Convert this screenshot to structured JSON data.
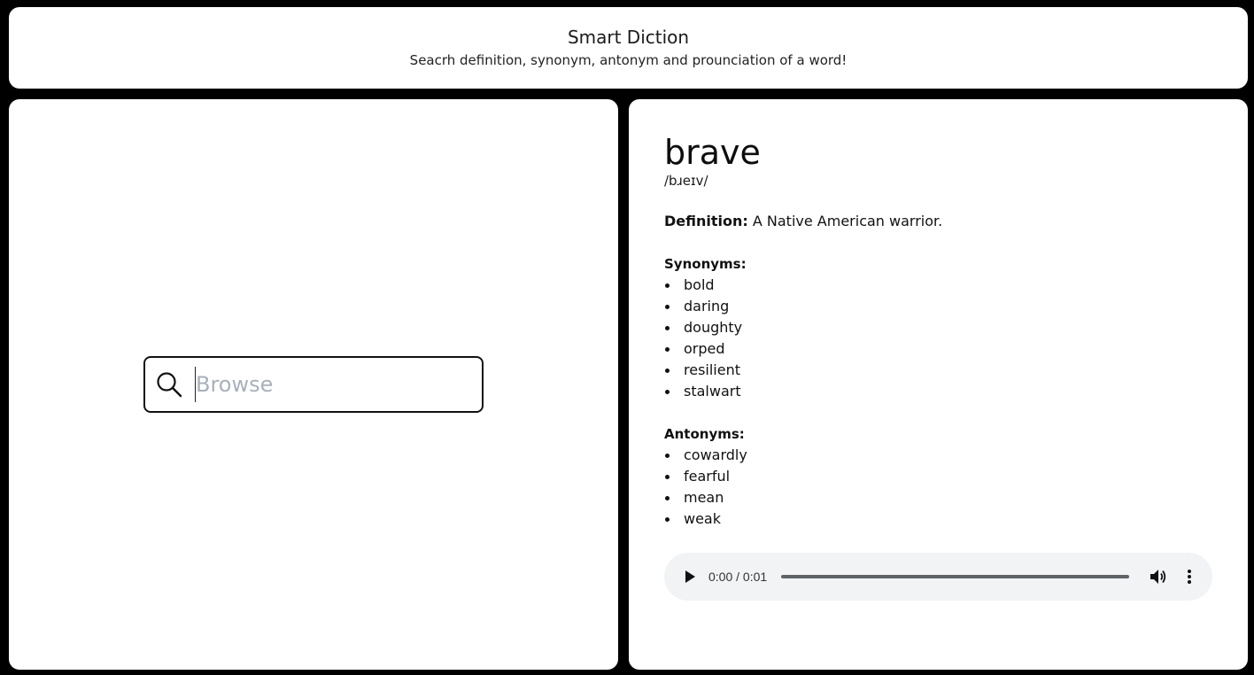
{
  "header": {
    "title": "Smart Diction",
    "subtitle": "Seacrh definition, synonym, antonym and prounciation of a word!"
  },
  "search": {
    "placeholder": "Browse",
    "value": "",
    "icon": "search-icon"
  },
  "result": {
    "word": "brave",
    "phonetic": "/bɹeɪv/",
    "definition_label": "Definition:",
    "definition_text": " A Native American warrior.",
    "synonyms_label": "Synonyms:",
    "synonyms": [
      "bold",
      "daring",
      "doughty",
      "orped",
      "resilient",
      "stalwart"
    ],
    "antonyms_label": "Antonyms:",
    "antonyms": [
      "cowardly",
      "fearful",
      "mean",
      "weak"
    ]
  },
  "audio": {
    "time": "0:00 / 0:01",
    "progress": 0,
    "icons": [
      "play-icon",
      "volume-icon",
      "more-options-icon"
    ]
  },
  "colors": {
    "background": "#000000",
    "panel": "#ffffff",
    "placeholder": "#a9b0ba",
    "player_bg": "#f1f3f4"
  }
}
